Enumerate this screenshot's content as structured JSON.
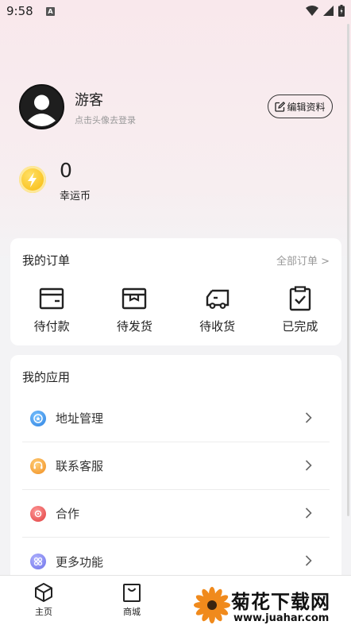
{
  "status_bar": {
    "time": "9:58",
    "notification_letter": "A"
  },
  "profile": {
    "name": "游客",
    "hint": "点击头像去登录",
    "edit_label": "编辑资料"
  },
  "coins": {
    "value": "0",
    "label": "幸运币"
  },
  "orders": {
    "title": "我的订单",
    "all_link": "全部订单 >",
    "items": [
      {
        "label": "待付款",
        "icon": "wallet-icon"
      },
      {
        "label": "待发货",
        "icon": "package-icon"
      },
      {
        "label": "待收货",
        "icon": "truck-icon"
      },
      {
        "label": "已完成",
        "icon": "clipboard-check-icon"
      }
    ]
  },
  "apps": {
    "title": "我的应用",
    "items": [
      {
        "label": "地址管理",
        "icon": "address-icon",
        "color": "#3a8ee6"
      },
      {
        "label": "联系客服",
        "icon": "customer-service-icon",
        "color": "#f5a03a"
      },
      {
        "label": "合作",
        "icon": "cooperation-icon",
        "color": "#ef5a5a"
      },
      {
        "label": "更多功能",
        "icon": "more-icon",
        "color": "#7b7ef0"
      }
    ]
  },
  "tabs": [
    {
      "label": "主页",
      "icon": "cube-icon"
    },
    {
      "label": "商城",
      "icon": "shopping-bag-icon"
    }
  ],
  "watermark": {
    "title": "菊花下载网",
    "url": "www.juahar.com"
  },
  "colors": {
    "accent": "#f7b500",
    "background_top": "#f9e8ec",
    "background": "#f3f3f5"
  }
}
